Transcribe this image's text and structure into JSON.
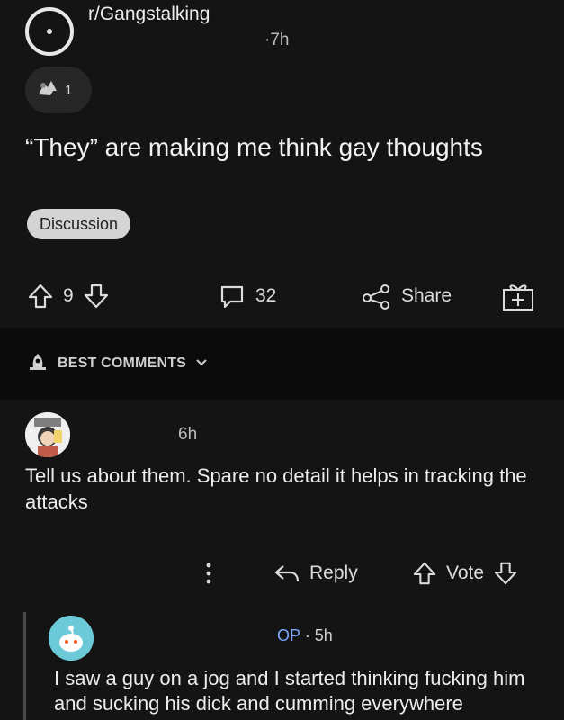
{
  "post": {
    "subreddit": "r/Gangstalking",
    "time": "·7h",
    "award_count": "1",
    "title": "“They” are making me think gay thoughts",
    "flair": "Discussion",
    "upvotes": "9",
    "comments": "32",
    "share_label": "Share"
  },
  "sort": {
    "label": "BEST COMMENTS"
  },
  "comments": [
    {
      "time": "6h",
      "body": "Tell us about them. Spare no detail it helps in tracking the attacks",
      "reply_label": "Reply",
      "vote_label": "Vote"
    },
    {
      "author_badge": "OP",
      "time": "· 5h",
      "body": "I saw a guy on a jog and I started thinking fucking him and sucking his dick and cumming everywhere"
    }
  ],
  "icons": {
    "subreddit": "subreddit-icon",
    "award": "award-icon",
    "upvote": "upvote-arrow-icon",
    "downvote": "downvote-arrow-icon",
    "comment": "comment-bubble-icon",
    "share": "share-icon",
    "gift": "gift-icon",
    "sort": "rocket-icon",
    "more": "more-vertical-icon",
    "reply": "reply-arrow-icon"
  }
}
